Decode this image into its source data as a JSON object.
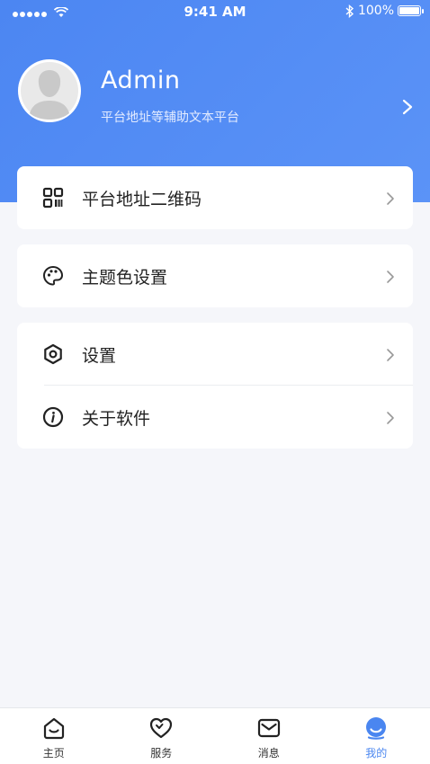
{
  "status_bar": {
    "time": "9:41 AM",
    "battery": "100%"
  },
  "profile": {
    "name": "Admin",
    "subtitle": "平台地址等辅助文本平台"
  },
  "menu": {
    "qrcode": "平台地址二维码",
    "theme": "主题色设置",
    "settings": "设置",
    "about": "关于软件"
  },
  "tabs": [
    {
      "label": "主页",
      "icon": "home-icon"
    },
    {
      "label": "服务",
      "icon": "heart-icon"
    },
    {
      "label": "消息",
      "icon": "mail-icon"
    },
    {
      "label": "我的",
      "icon": "user-icon"
    }
  ],
  "colors": {
    "accent": "#4a86f0",
    "header": "#508af4",
    "background": "#f5f6fa"
  }
}
